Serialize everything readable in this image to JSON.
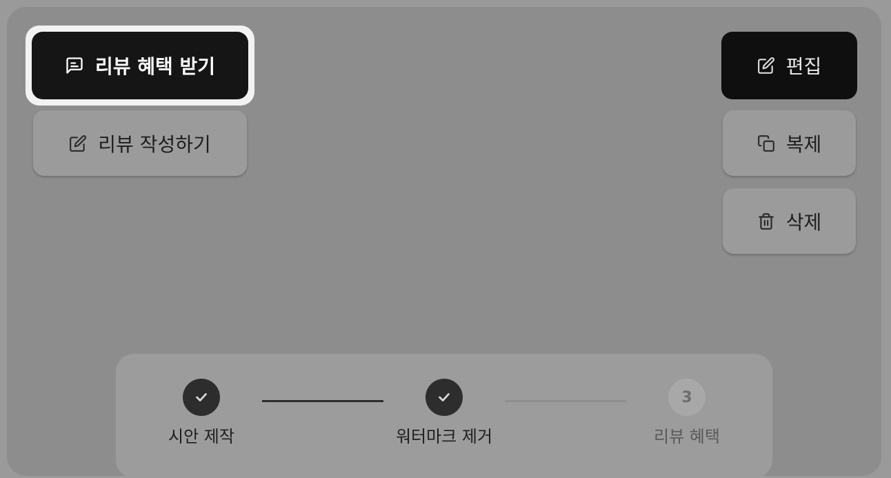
{
  "actions": {
    "review_benefit": {
      "label": "리뷰 혜택 받기",
      "icon": "message-square-text-icon"
    },
    "write_review": {
      "label": "리뷰 작성하기",
      "icon": "pencil-square-icon"
    },
    "edit": {
      "label": "편집",
      "icon": "pencil-square-icon"
    },
    "duplicate": {
      "label": "복제",
      "icon": "copy-icon"
    },
    "delete": {
      "label": "삭제",
      "icon": "trash-icon"
    }
  },
  "progress": {
    "steps": [
      {
        "label": "시안 제작",
        "status": "done",
        "marker": "check-icon"
      },
      {
        "label": "워터마크 제거",
        "status": "done",
        "marker": "check-icon"
      },
      {
        "label": "리뷰 혜택",
        "status": "pending",
        "number": "3"
      }
    ]
  },
  "colors": {
    "dark_button": "#151515",
    "light_button": "#9b9b9b",
    "background": "#8d8d8d",
    "step_done": "#2d2d2d",
    "step_pending": "#a8a8a8"
  }
}
